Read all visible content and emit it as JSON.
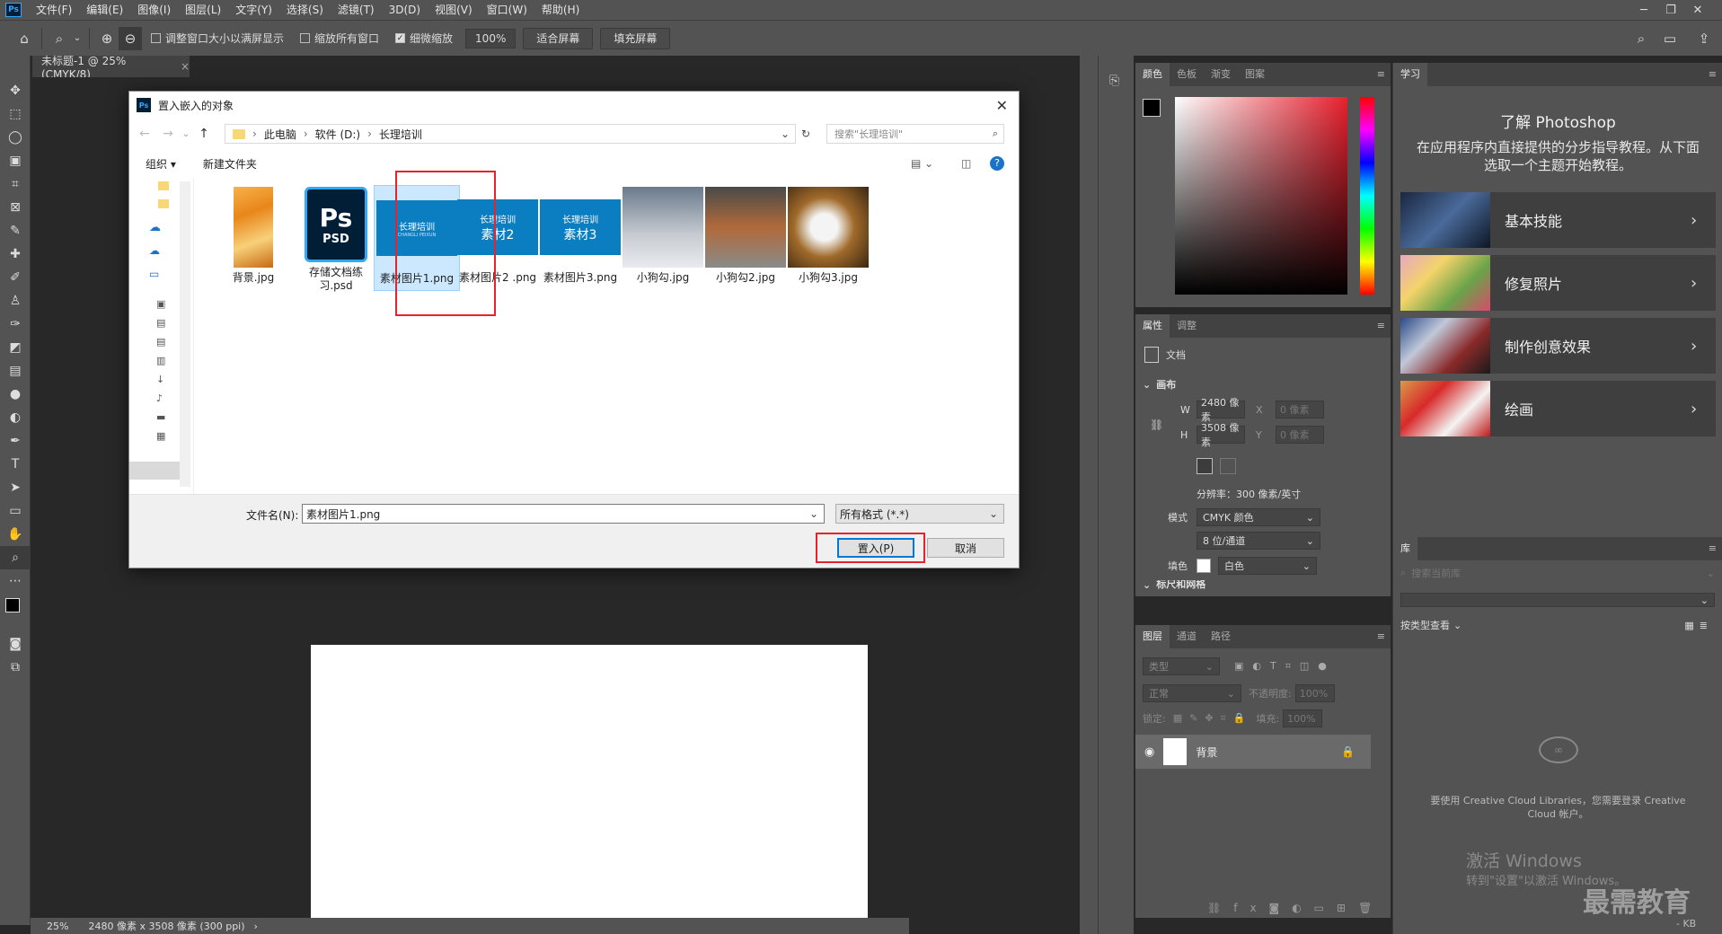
{
  "app": {
    "menus": [
      "文件(F)",
      "编辑(E)",
      "图像(I)",
      "图层(L)",
      "文字(Y)",
      "选择(S)",
      "滤镜(T)",
      "3D(D)",
      "视图(V)",
      "窗口(W)",
      "帮助(H)"
    ]
  },
  "options": {
    "resize_windows": "调整窗口大小以满屏显示",
    "zoom_all": "缩放所有窗口",
    "scrubby_zoom": "细微缩放",
    "zoom_value": "100%",
    "fit_screen": "适合屏幕",
    "fill_screen": "填充屏幕"
  },
  "document": {
    "tab_title": "未标题-1 @ 25%(CMYK/8)",
    "status_zoom": "25%",
    "status_info": "2480 像素 x 3508 像素 (300 ppi)"
  },
  "color_panel": {
    "tabs": [
      "颜色",
      "色板",
      "渐变",
      "图案"
    ]
  },
  "properties": {
    "tabs": [
      "属性",
      "调整"
    ],
    "doc_label": "文档",
    "section": "画布",
    "w_label": "W",
    "w_value": "2480 像素",
    "h_label": "H",
    "h_value": "3508 像素",
    "x_label": "X",
    "x_placeholder": "0 像素",
    "y_label": "Y",
    "y_placeholder": "0 像素",
    "resolution": "分辨率：300 像素/英寸",
    "mode_label": "模式",
    "mode_value": "CMYK 颜色",
    "depth_value": "8 位/通道",
    "fill_label": "填色",
    "fill_value": "白色",
    "cut_off_section": "标尺和网格"
  },
  "layers": {
    "tabs": [
      "图层",
      "通道",
      "路径"
    ],
    "filter_placeholder": "类型",
    "blend": "正常",
    "opacity_label": "不透明度:",
    "opacity_value": "100%",
    "lock_label": "锁定:",
    "fill_label": "填充:",
    "fill_value": "100%",
    "layer_name": "背景"
  },
  "learn": {
    "tab": "学习",
    "title": "了解 Photoshop",
    "desc": "在应用程序内直接提供的分步指导教程。从下面选取一个主题开始教程。",
    "cards": [
      "基本技能",
      "修复照片",
      "制作创意效果",
      "绘画"
    ]
  },
  "library": {
    "tab": "库",
    "search_placeholder": "搜索当前库",
    "view_by": "按类型查看",
    "message": "要使用 Creative Cloud Libraries，您需要登录 Creative Cloud 帐户。"
  },
  "watermark": {
    "activate": "激活 Windows",
    "activate_sub": "转到\"设置\"以激活 Windows。",
    "brand": "最需教育",
    "kb": "- KB"
  },
  "dialog": {
    "title": "置入嵌入的对象",
    "path": [
      "此电脑",
      "软件 (D:)",
      "长理培训"
    ],
    "search_placeholder": "搜索\"长理培训\"",
    "organize": "组织 ▾",
    "new_folder": "新建文件夹",
    "files": [
      {
        "name": "背景.jpg"
      },
      {
        "name": "存储文档练习.psd"
      },
      {
        "name": "素材图片1.png",
        "thumb_title": "长理培训",
        "thumb_sub": "CHANGLI PEIXUN"
      },
      {
        "name": "素材图片2 .png",
        "thumb_title": "长理培训",
        "thumb_sub": "素材2"
      },
      {
        "name": "素材图片3.png",
        "thumb_title": "长理培训",
        "thumb_sub": "素材3"
      },
      {
        "name": "小狗勾.jpg"
      },
      {
        "name": "小狗勾2.jpg"
      },
      {
        "name": "小狗勾3.jpg"
      }
    ],
    "filename_label": "文件名(N):",
    "filename_value": "素材图片1.png",
    "filetype": "所有格式 (*.*)",
    "place_button": "置入(P)",
    "cancel_button": "取消"
  },
  "colors": {
    "accent_red": "#e8222b",
    "selection": "#cce8ff",
    "thumb_blue": "#0b7ec2",
    "ps_blue": "#31a8ff"
  }
}
